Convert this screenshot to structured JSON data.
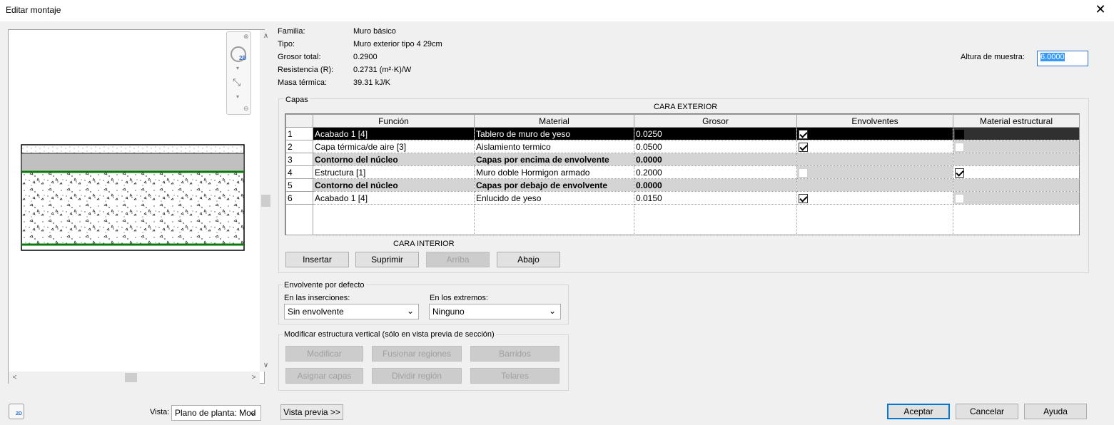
{
  "window": {
    "title": "Editar montaje"
  },
  "info": {
    "rows": [
      {
        "label": "Familia:",
        "value": "Muro básico"
      },
      {
        "label": "Tipo:",
        "value": "Muro exterior tipo 4 29cm"
      },
      {
        "label": "Grosor total:",
        "value": "0.2900"
      },
      {
        "label": "Resistencia (R):",
        "value": "0.2731 (m²·K)/W"
      },
      {
        "label": "Masa térmica:",
        "value": "39.31 kJ/K"
      }
    ],
    "sample_height_label": "Altura de muestra:",
    "sample_height_value": "6.0000"
  },
  "layers": {
    "group_label": "Capas",
    "exterior_label": "CARA EXTERIOR",
    "interior_label": "CARA INTERIOR",
    "headers": [
      "Función",
      "Material",
      "Grosor",
      "Envolventes",
      "Material estructural"
    ],
    "rows": [
      {
        "n": "1",
        "funcion": "Acabado 1 [4]",
        "material": "Tablero de muro de yeso",
        "grosor": "0.0250"
      },
      {
        "n": "2",
        "funcion": "Capa térmica/de aire [3]",
        "material": "Aislamiento termico",
        "grosor": "0.0500"
      },
      {
        "n": "3",
        "funcion": "Contorno del núcleo",
        "material": "Capas por encima de envolvente",
        "grosor": "0.0000"
      },
      {
        "n": "4",
        "funcion": "Estructura [1]",
        "material": "Muro doble Hormigon armado",
        "grosor": "0.2000"
      },
      {
        "n": "5",
        "funcion": "Contorno del núcleo",
        "material": "Capas por debajo de envolvente",
        "grosor": "0.0000"
      },
      {
        "n": "6",
        "funcion": "Acabado 1 [4]",
        "material": "Enlucido de yeso",
        "grosor": "0.0150"
      }
    ],
    "buttons": {
      "insert": "Insertar",
      "delete": "Suprimir",
      "up": "Arriba",
      "down": "Abajo"
    }
  },
  "wrapping": {
    "group_label": "Envolvente por defecto",
    "inserts_label": "En las inserciones:",
    "inserts_value": "Sin envolvente",
    "ends_label": "En los extremos:",
    "ends_value": "Ninguno"
  },
  "vertical": {
    "group_label": "Modificar estructura vertical (sólo en vista previa de sección)",
    "buttons": {
      "modify": "Modificar",
      "merge": "Fusionar regiones",
      "sweeps": "Barridos",
      "assign": "Asignar capas",
      "split": "Dividir región",
      "reveals": "Telares"
    }
  },
  "bottom": {
    "view_label": "Vista:",
    "view_value": "Plano de planta: Mod",
    "preview_button": "Vista previa >>",
    "ok": "Aceptar",
    "cancel": "Cancelar",
    "help": "Ayuda"
  },
  "nav_icon_text": "2D",
  "colors": {
    "core_line": "#0a7a0a",
    "selection": "#000000",
    "accent": "#0078d7"
  }
}
